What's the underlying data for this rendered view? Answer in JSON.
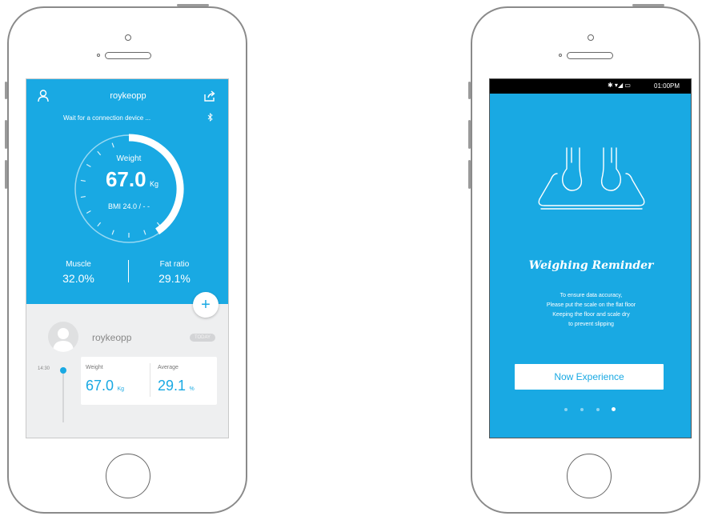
{
  "left_phone": {
    "header": {
      "username": "roykeopp",
      "connection_status": "Wait for a connection device ..."
    },
    "gauge": {
      "label": "Weight",
      "value": "67.0",
      "unit": "Kg",
      "bmi": "BMI 24.0 / - -",
      "progress_fraction": 0.33
    },
    "stats": {
      "muscle_label": "Muscle",
      "muscle_value": "32.0%",
      "fat_label": "Fat ratio",
      "fat_value": "29.1%"
    },
    "add_label": "+",
    "profile": {
      "name": "roykeopp",
      "badge": "TODAY"
    },
    "record": {
      "time": "14:30",
      "weight_label": "Weight",
      "weight_value": "67.0",
      "weight_unit": "Kg",
      "average_label": "Average",
      "average_value": "29.1",
      "average_unit": "%"
    }
  },
  "right_phone": {
    "statusbar": {
      "icons": "✱ ▾◢ ▭",
      "time": "01:00PM"
    },
    "title": "Weighing Reminder",
    "body_lines": [
      "To ensure data accuracy,",
      "Please put the scale on the flat floor",
      "Keeping the floor and scale dry",
      "to prevent slipping"
    ],
    "cta_label": "Now Experience",
    "pager": {
      "count": 4,
      "active_index": 3
    }
  },
  "colors": {
    "primary": "#19a9e3",
    "accent_text": "#19a9e3",
    "phone_outline": "#8a8a8a"
  }
}
